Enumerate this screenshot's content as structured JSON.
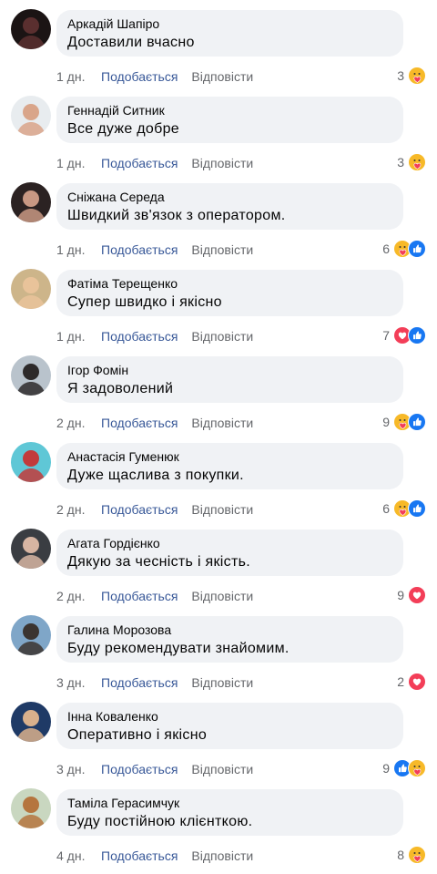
{
  "colors": {
    "bubble_bg": "#f0f2f5",
    "like_link": "#385898",
    "meta_text": "#65676b",
    "like_blue": "#1877f2",
    "love_red": "#f33e58",
    "care_yellow": "#f7b928"
  },
  "comments": [
    {
      "author": "Аркадій Шапіро",
      "text": "Доставили вчасно",
      "time": "1 дн.",
      "like": "Подобається",
      "reply": "Відповісти",
      "count": "3",
      "reactions": [
        "care-icon"
      ],
      "avatar": [
        "#1b1414",
        "#5a2f2f"
      ]
    },
    {
      "author": "Геннадій Ситник",
      "text": "Все дуже добре",
      "time": "1 дн.",
      "like": "Подобається",
      "reply": "Відповісти",
      "count": "3",
      "reactions": [
        "care-icon"
      ],
      "avatar": [
        "#e8ecef",
        "#d9a58a"
      ]
    },
    {
      "author": "Сніжана Середа",
      "text": "Швидкий зв'язок з оператором.",
      "time": "1 дн.",
      "like": "Подобається",
      "reply": "Відповісти",
      "count": "6",
      "reactions": [
        "care-icon",
        "like-icon"
      ],
      "avatar": [
        "#2b2222",
        "#c89883"
      ]
    },
    {
      "author": "Фатіма Терещенко",
      "text": "Супер швидко і якісно",
      "time": "1 дн.",
      "like": "Подобається",
      "reply": "Відповісти",
      "count": "7",
      "reactions": [
        "love-icon",
        "like-icon"
      ],
      "avatar": [
        "#cdb58a",
        "#e9c39a"
      ]
    },
    {
      "author": "Ігор Фомін",
      "text": "Я задоволений",
      "time": "2 дн.",
      "like": "Подобається",
      "reply": "Відповісти",
      "count": "9",
      "reactions": [
        "care-icon",
        "like-icon"
      ],
      "avatar": [
        "#b9c3cc",
        "#2d2a2a"
      ]
    },
    {
      "author": "Анастасія Гуменюк",
      "text": "Дуже щаслива з покупки.",
      "time": "2 дн.",
      "like": "Подобається",
      "reply": "Відповісти",
      "count": "6",
      "reactions": [
        "care-icon",
        "like-icon"
      ],
      "avatar": [
        "#5fc7d6",
        "#c23b3b"
      ]
    },
    {
      "author": "Агата Гордієнко",
      "text": "Дякую за чесність і якість.",
      "time": "2 дн.",
      "like": "Подобається",
      "reply": "Відповісти",
      "count": "9",
      "reactions": [
        "love-icon"
      ],
      "avatar": [
        "#3a3d42",
        "#d7b5a2"
      ]
    },
    {
      "author": "Галина Морозова",
      "text": "Буду рекомендувати знайомим.",
      "time": "3 дн.",
      "like": "Подобається",
      "reply": "Відповісти",
      "count": "2",
      "reactions": [
        "love-icon"
      ],
      "avatar": [
        "#7fa6c8",
        "#3b3430"
      ]
    },
    {
      "author": "Інна Коваленко",
      "text": "Оперативно і якісно",
      "time": "3 дн.",
      "like": "Подобається",
      "reply": "Відповісти",
      "count": "9",
      "reactions": [
        "like-icon",
        "care-icon"
      ],
      "avatar": [
        "#1f3a66",
        "#d9b08c"
      ]
    },
    {
      "author": "Таміла Герасимчук",
      "text": "Буду постійною клієнткою.",
      "time": "4 дн.",
      "like": "Подобається",
      "reply": "Відповісти",
      "count": "8",
      "reactions": [
        "care-icon"
      ],
      "avatar": [
        "#c9d7c0",
        "#b5753e"
      ]
    }
  ]
}
